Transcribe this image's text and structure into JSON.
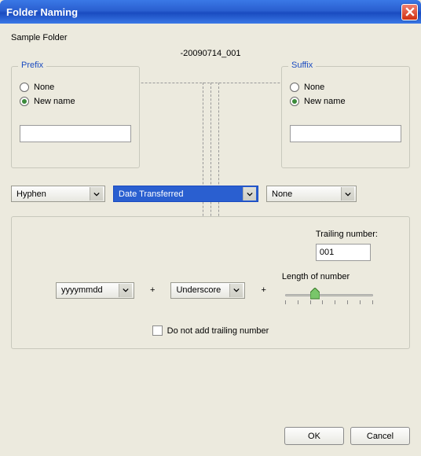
{
  "window": {
    "title": "Folder Naming"
  },
  "sample_label": "Sample Folder",
  "preview": "-20090714_001",
  "prefix": {
    "legend": "Prefix",
    "options": {
      "none": "None",
      "new_name": "New name"
    },
    "selected": "new_name",
    "input_value": ""
  },
  "suffix": {
    "legend": "Suffix",
    "options": {
      "none": "None",
      "new_name": "New name"
    },
    "selected": "new_name",
    "input_value": ""
  },
  "separator_left": {
    "value": "Hyphen"
  },
  "center_source": {
    "value": "Date Transferred"
  },
  "separator_right": {
    "value": "None"
  },
  "date_format": {
    "value": "yyyymmdd"
  },
  "mid_separator": {
    "value": "Underscore"
  },
  "trailing": {
    "label": "Trailing number:",
    "value": "001",
    "length_label": "Length of number"
  },
  "do_not_add": {
    "label": "Do not add trailing number",
    "checked": false
  },
  "buttons": {
    "ok": "OK",
    "cancel": "Cancel"
  },
  "plus": "+"
}
